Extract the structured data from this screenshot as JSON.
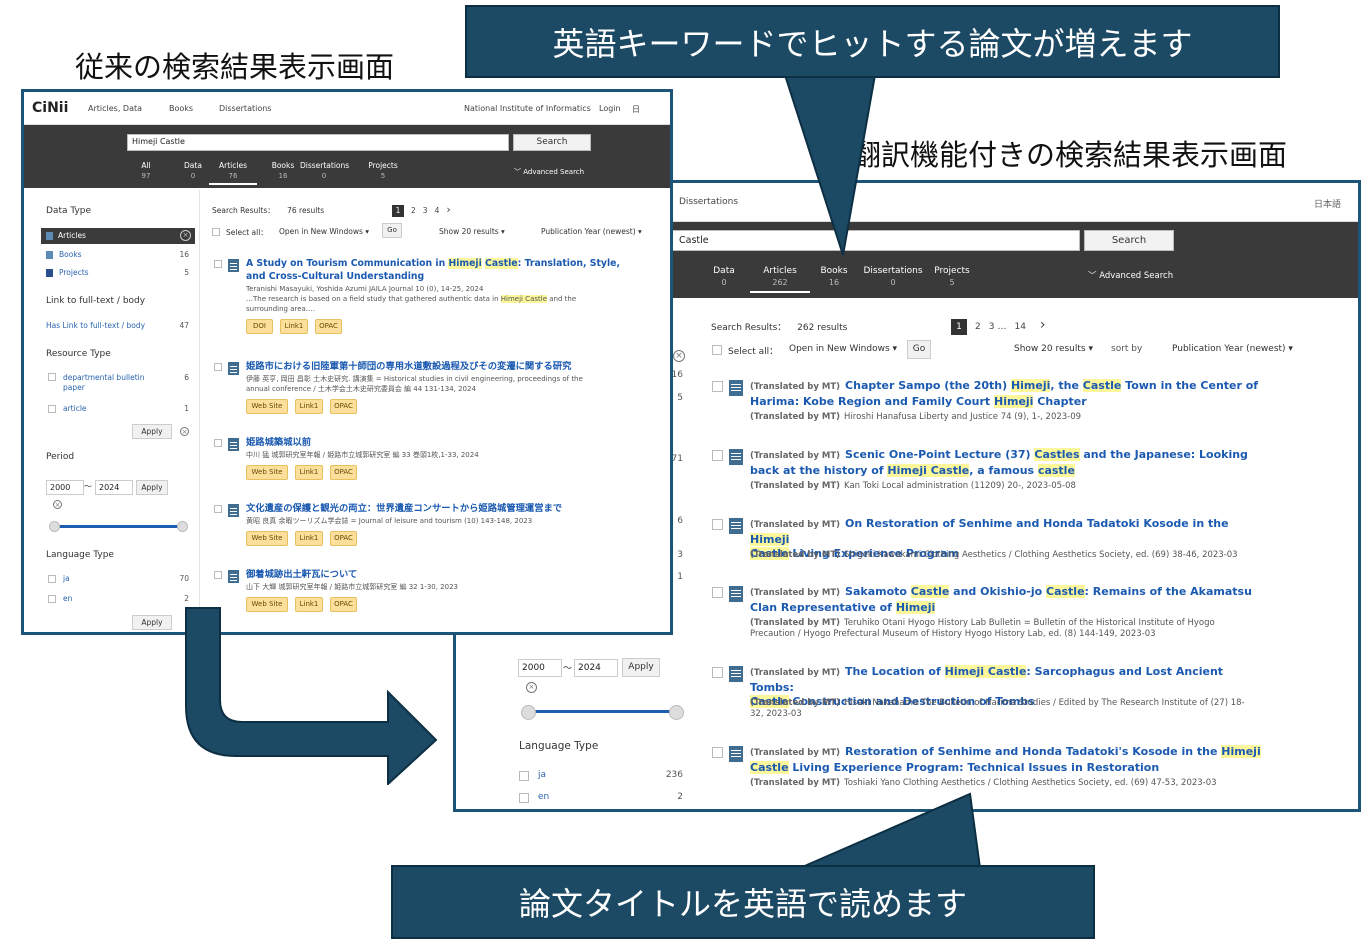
{
  "headings": {
    "old": "従来の検索結果表示画面",
    "new": "翻訳機能付きの検索結果表示画面"
  },
  "callouts": {
    "top": "英語キーワードでヒットする論文が増えます",
    "bottom": "論文タイトルを英語で読めます"
  },
  "old": {
    "logo": "CiNii",
    "nav": [
      "Articles, Data",
      "Books",
      "Dissertations"
    ],
    "nav_right": [
      "National Institute of Informatics",
      "Login",
      "日"
    ],
    "query": "Himeji Castle",
    "search_label": "Search",
    "tabs": [
      {
        "label": "All",
        "count": "97"
      },
      {
        "label": "Data",
        "count": "0"
      },
      {
        "label": "Articles",
        "count": "76"
      },
      {
        "label": "Books",
        "count": "16"
      },
      {
        "label": "Dissertations",
        "count": "0"
      },
      {
        "label": "Projects",
        "count": "5"
      }
    ],
    "advanced": "Advanced Search",
    "sidebar": {
      "data_type": "Data Type",
      "types": [
        {
          "label": "Articles",
          "count": ""
        },
        {
          "label": "Books",
          "count": "16"
        },
        {
          "label": "Projects",
          "count": "5"
        }
      ],
      "link_fulltext": "Link to full-text / body",
      "has_link": "Has Link to full-text / body",
      "has_link_count": "47",
      "resource_type": "Resource Type",
      "resources": [
        {
          "label": "departmental bulletin paper",
          "count": "6"
        },
        {
          "label": "article",
          "count": "1"
        }
      ],
      "apply": "Apply",
      "period": "Period",
      "from": "2000",
      "to": "2024",
      "tilde": "～",
      "language_type": "Language Type",
      "languages": [
        {
          "label": "ja",
          "count": "70"
        },
        {
          "label": "en",
          "count": "2"
        }
      ]
    },
    "results_label": "Search Results：",
    "results_count": "76 results",
    "pages": [
      "1",
      "2",
      "3",
      "4"
    ],
    "select_all": "Select all：",
    "open_new": "Open in New Windows ▾",
    "go": "Go",
    "show": "Show 20 results ▾",
    "sort": "Publication Year (newest) ▾",
    "results": [
      {
        "t1": "A Study on Tourism Communication in ",
        "h1": "Himeji",
        "t2": " ",
        "h2": "Castle",
        "t3": ": Translation, Style,",
        "t4": "and Cross-Cultural Understanding",
        "meta1": "Teranishi Masayuki, Yoshida Azumi JAILA Journal 10 (0), 14-25, 2024",
        "meta2a": "…The research is based on a field study that gathered authentic data in ",
        "meta2h": "Himeji Castle",
        "meta2b": " and the",
        "meta3": "surrounding area.…",
        "pills": [
          "DOI",
          "Link1",
          "OPAC"
        ]
      },
      {
        "title": "姫路市における旧陸軍第十師団の専用水道敷設過程及びその変遷に関する研究",
        "meta1": "伊藤 英亨, 岡田 昌彰 土木史研究. 講演集 = Historical studies in civil engineering, proceedings of the",
        "meta2": "annual conference / 土木学会土木史研究委員会 編 44 131-134, 2024",
        "pills": [
          "Web Site",
          "Link1",
          "OPAC"
        ]
      },
      {
        "title": "姫路城築城以前",
        "meta1": "中川 猛 城郭研究室年報 / 姫路市立城郭研究室 編 33 巻頭1枚,1-33, 2024",
        "pills": [
          "Web Site",
          "Link1",
          "OPAC"
        ]
      },
      {
        "title": "文化遺産の保護と観光の両立：世界遺産コンサートから姫路城管理運営まで",
        "meta1": "黄昭 良真 余暇ツーリズム学会誌 = Journal of leisure and tourism (10) 143-148, 2023",
        "pills": [
          "Web Site",
          "Link1",
          "OPAC"
        ]
      },
      {
        "title": "御着城跡出土軒瓦について",
        "meta1": "山下 大輝 城郭研究室年報 / 姫路市立城郭研究室 編 32 1-30, 2023",
        "pills": [
          "Web Site",
          "Link1",
          "OPAC"
        ]
      }
    ]
  },
  "new": {
    "nav": "Dissertations",
    "lang": "日本語",
    "query": "Castle",
    "search_label": "Search",
    "tabs": [
      {
        "label": "Data",
        "count": "0"
      },
      {
        "label": "Articles",
        "count": "262"
      },
      {
        "label": "Books",
        "count": "16"
      },
      {
        "label": "Dissertations",
        "count": "0"
      },
      {
        "label": "Projects",
        "count": "5"
      }
    ],
    "advanced": "Advanced Search",
    "results_label": "Search Results：",
    "results_count": "262 results",
    "pages": [
      "1",
      "2",
      "3",
      "…",
      "14"
    ],
    "select_all": "Select all：",
    "open_new": "Open in New Windows ▾",
    "go": "Go",
    "show": "Show 20 results ▾",
    "sort_by": "sort by",
    "sort": "Publication Year (newest) ▾",
    "side_counts": [
      "16",
      "5",
      "71",
      "6",
      "3",
      "1"
    ],
    "period_from": "2000",
    "period_to": "2024",
    "tilde": "～",
    "apply": "Apply",
    "language_type": "Language Type",
    "languages": [
      {
        "label": "ja",
        "count": "236"
      },
      {
        "label": "en",
        "count": "2"
      }
    ],
    "mt": "(Translated by MT)",
    "results": [
      {
        "line1": [
          [
            "Chapter Sampo (the 20th) ",
            ""
          ],
          [
            "Himeji",
            "h"
          ],
          [
            ", the ",
            ""
          ],
          [
            "Castle",
            "h"
          ],
          [
            " Town in the Center of",
            ""
          ]
        ],
        "line2": [
          [
            "Harima: Kobe Region and Family Court ",
            ""
          ],
          [
            "Himeji",
            "h"
          ],
          [
            " Chapter",
            ""
          ]
        ],
        "meta1": "Hiroshi Hanafusa Liberty and Justice 74 (9), 1-, 2023-09"
      },
      {
        "line1": [
          [
            "Scenic One-Point Lecture (37) ",
            ""
          ],
          [
            "Castles",
            "h"
          ],
          [
            " and the Japanese: Looking",
            ""
          ]
        ],
        "line2": [
          [
            "back at the history of ",
            ""
          ],
          [
            "Himeji Castle",
            "h"
          ],
          [
            ", a famous ",
            ""
          ],
          [
            "castle",
            "h"
          ]
        ],
        "meta1": "Kan Toki Local administration (11209) 20-, 2023-05-08"
      },
      {
        "line1": [
          [
            "On Restoration of Senhime and Honda Tadatoki Kosode in the ",
            ""
          ],
          [
            "Himeji",
            "h"
          ]
        ],
        "line2": [
          [
            "Castle",
            "h"
          ],
          [
            " Living Experience Program",
            ""
          ]
        ],
        "meta1": "Shigeki Kawakami Clothing Aesthetics / Clothing Aesthetics Society, ed. (69) 38-46, 2023-03"
      },
      {
        "line1": [
          [
            "Sakamoto ",
            ""
          ],
          [
            "Castle",
            "h"
          ],
          [
            " and Okishio-jo ",
            ""
          ],
          [
            "Castle",
            "h"
          ],
          [
            ": Remains of the Akamatsu",
            ""
          ]
        ],
        "line2": [
          [
            "Clan Representative of ",
            ""
          ],
          [
            "Himeji",
            "h"
          ]
        ],
        "meta1": "Teruhiko Otani Hyogo History Lab Bulletin = Bulletin of the Historical Institute of Hyogo",
        "meta2": "Precaution / Hyogo Prefectural Museum of History Hyogo History Lab, ed. (8) 144-149, 2023-03"
      },
      {
        "line1": [
          [
            "The Location of ",
            ""
          ],
          [
            "Himeji Castle",
            "h"
          ],
          [
            ": Sarcophagus and Lost Ancient Tombs:",
            ""
          ]
        ],
        "line2": [
          [
            "Castle",
            "h"
          ],
          [
            " Construction and Destruction of Tombs",
            ""
          ]
        ],
        "meta1": "Hisaki Nakahama The Bulletin of Harima Studies / Edited by The Research Institute of (27) 18-",
        "meta2": "32, 2023-03"
      },
      {
        "line1": [
          [
            "Restoration of Senhime and Honda Tadatoki's Kosode in the ",
            ""
          ],
          [
            "Himeji",
            "h"
          ]
        ],
        "line2": [
          [
            "Castle",
            "h"
          ],
          [
            " Living Experience Program: Technical Issues in Restoration",
            ""
          ]
        ],
        "meta1": "Toshiaki Yano Clothing Aesthetics / Clothing Aesthetics Society, ed. (69) 47-53, 2023-03"
      }
    ]
  },
  "colors": {
    "callout_bg": "#1c4a64",
    "frame_border": "#1c5578",
    "highlight": "#fbf79a",
    "link": "#1b5ab0"
  }
}
